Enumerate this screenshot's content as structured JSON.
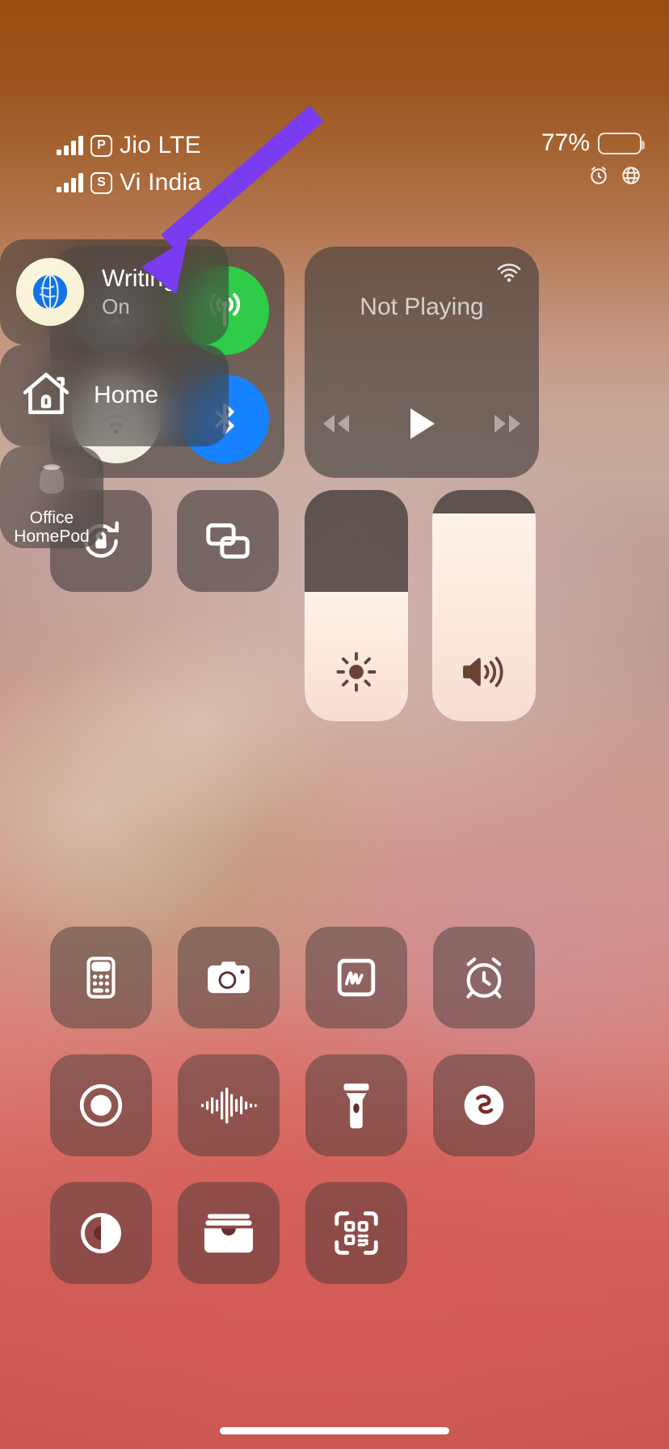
{
  "status_bar": {
    "carriers": [
      {
        "sim": "P",
        "name": "Jio LTE",
        "signal_bars": 4
      },
      {
        "sim": "S",
        "name": "Vi India",
        "signal_bars": 4
      }
    ],
    "battery_percent": "77%",
    "battery_level": 77,
    "indicators": [
      "alarm-icon",
      "globe-icon"
    ]
  },
  "control_center": {
    "connectivity": {
      "airplane": {
        "label": "Airplane Mode",
        "state": "off",
        "color": "#828080"
      },
      "cellular": {
        "label": "Cellular Data",
        "state": "on",
        "color": "#2ecc48"
      },
      "wifi": {
        "label": "Wi-Fi",
        "state": "on",
        "color": "#f4f0e6"
      },
      "bluetooth": {
        "label": "Bluetooth",
        "state": "on",
        "color": "#1782ff"
      }
    },
    "media": {
      "title": "Not Playing",
      "airplay_label": "AirPlay",
      "controls": [
        "rewind",
        "play",
        "fast-forward"
      ]
    },
    "rotation_lock": {
      "label": "Portrait Orientation Lock",
      "state": "off"
    },
    "screen_mirroring": {
      "label": "Screen Mirroring"
    },
    "brightness": {
      "label": "Display Brightness",
      "value": 56
    },
    "volume": {
      "label": "Volume",
      "value": 90
    },
    "focus": {
      "name": "Writing",
      "state": "On"
    },
    "home": {
      "label": "Home"
    },
    "homepod": {
      "label": "Office HomePod",
      "line1": "Office",
      "line2": "HomePod"
    },
    "apps": [
      {
        "name": "calculator",
        "label": "Calculator"
      },
      {
        "name": "camera",
        "label": "Camera"
      },
      {
        "name": "quick-note",
        "label": "Quick Note"
      },
      {
        "name": "timer",
        "label": "Timer"
      },
      {
        "name": "screen-record",
        "label": "Screen Recording"
      },
      {
        "name": "voice-memo",
        "label": "Voice Memos"
      },
      {
        "name": "flashlight",
        "label": "Flashlight"
      },
      {
        "name": "shazam",
        "label": "Music Recognition"
      },
      {
        "name": "dark-mode",
        "label": "Dark Mode"
      },
      {
        "name": "wallet",
        "label": "Wallet"
      },
      {
        "name": "qr-scanner",
        "label": "Code Scanner"
      }
    ]
  },
  "annotation": {
    "arrow_color": "#7a3cf0",
    "points_at": "Airplane Mode"
  }
}
